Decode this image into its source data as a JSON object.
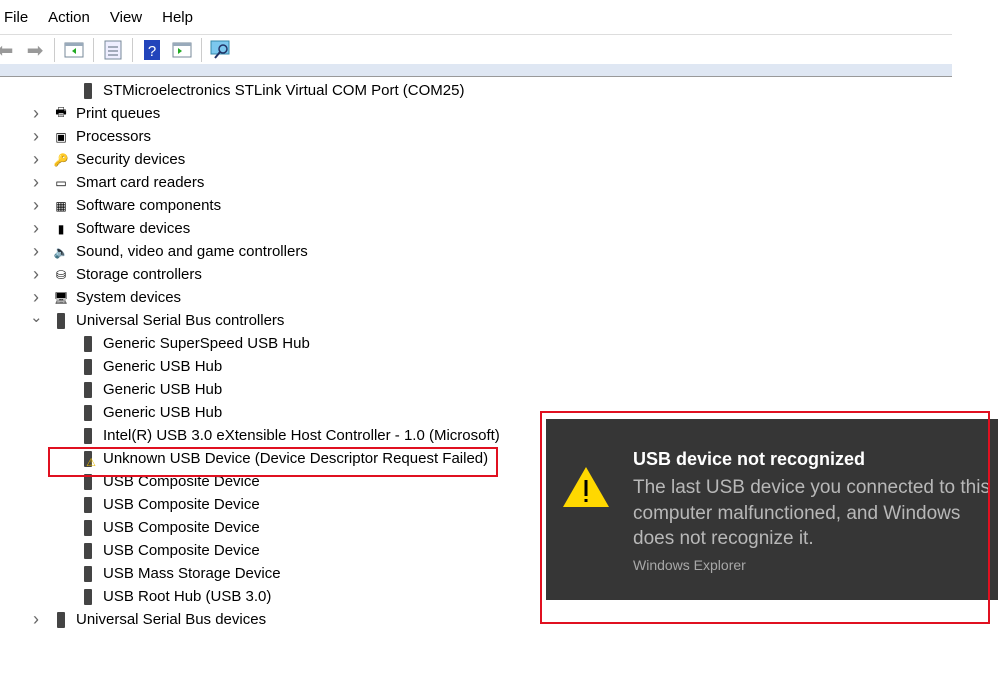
{
  "menu": [
    "File",
    "Action",
    "View",
    "Help"
  ],
  "tree": [
    {
      "level": 1,
      "label": "STMicroelectronics STLink Virtual COM Port (COM25)",
      "icon": "usb-connector-icon"
    },
    {
      "level": 0,
      "label": "Print queues",
      "icon": "printer-icon",
      "expanded": false
    },
    {
      "level": 0,
      "label": "Processors",
      "icon": "processor-icon",
      "expanded": false
    },
    {
      "level": 0,
      "label": "Security devices",
      "icon": "key-icon",
      "expanded": false
    },
    {
      "level": 0,
      "label": "Smart card readers",
      "icon": "smart-card-icon",
      "expanded": false
    },
    {
      "level": 0,
      "label": "Software components",
      "icon": "component-icon",
      "expanded": false
    },
    {
      "level": 0,
      "label": "Software devices",
      "icon": "device-icon",
      "expanded": false
    },
    {
      "level": 0,
      "label": "Sound, video and game controllers",
      "icon": "speaker-icon",
      "expanded": false
    },
    {
      "level": 0,
      "label": "Storage controllers",
      "icon": "storage-icon",
      "expanded": false
    },
    {
      "level": 0,
      "label": "System devices",
      "icon": "monitor-icon",
      "expanded": false
    },
    {
      "level": 0,
      "label": "Universal Serial Bus controllers",
      "icon": "usb-connector-icon",
      "expanded": true
    },
    {
      "level": 1,
      "label": "Generic SuperSpeed USB Hub",
      "icon": "usb-connector-icon"
    },
    {
      "level": 1,
      "label": "Generic USB Hub",
      "icon": "usb-connector-icon"
    },
    {
      "level": 1,
      "label": "Generic USB Hub",
      "icon": "usb-connector-icon"
    },
    {
      "level": 1,
      "label": "Generic USB Hub",
      "icon": "usb-connector-icon"
    },
    {
      "level": 1,
      "label": "Intel(R) USB 3.0 eXtensible Host Controller - 1.0 (Microsoft)",
      "icon": "usb-connector-icon"
    },
    {
      "level": 1,
      "label": "Unknown USB Device (Device Descriptor Request Failed)",
      "icon": "usb-warning-icon"
    },
    {
      "level": 1,
      "label": "USB Composite Device",
      "icon": "usb-connector-icon"
    },
    {
      "level": 1,
      "label": "USB Composite Device",
      "icon": "usb-connector-icon"
    },
    {
      "level": 1,
      "label": "USB Composite Device",
      "icon": "usb-connector-icon"
    },
    {
      "level": 1,
      "label": "USB Composite Device",
      "icon": "usb-connector-icon"
    },
    {
      "level": 1,
      "label": "USB Mass Storage Device",
      "icon": "usb-connector-icon"
    },
    {
      "level": 1,
      "label": "USB Root Hub (USB 3.0)",
      "icon": "usb-connector-icon"
    },
    {
      "level": 0,
      "label": "Universal Serial Bus devices",
      "icon": "usb-connector-icon",
      "expanded": false
    }
  ],
  "toast": {
    "title": "USB device not recognized",
    "body": "The last USB device you connected to this computer malfunctioned, and Windows does not recognize it.",
    "source": "Windows Explorer"
  },
  "colors": {
    "highlight": "#e01020",
    "toast_bg": "#363636",
    "warning": "#ffd800"
  }
}
